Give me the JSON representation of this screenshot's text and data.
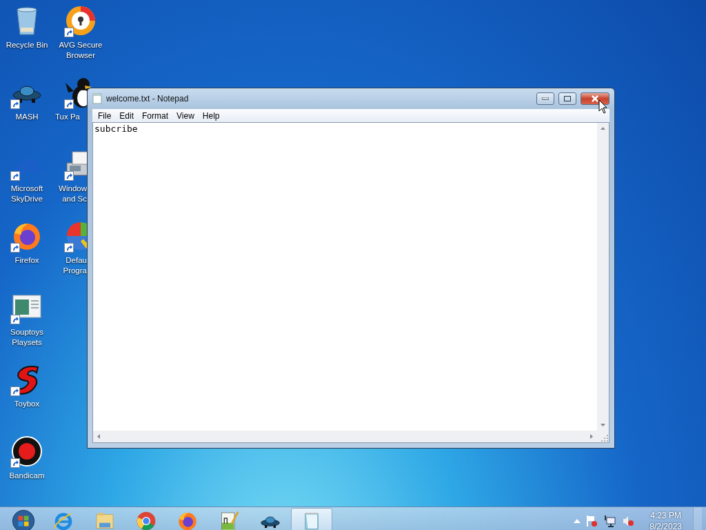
{
  "desktop_columns": [
    {
      "icons": [
        {
          "kind": "recycle-bin",
          "label": "Recycle Bin",
          "shortcut": false,
          "clipped": false
        },
        {
          "kind": "mash",
          "label": "MASH",
          "shortcut": true,
          "clipped": false
        },
        {
          "kind": "cloud",
          "label": "Microsoft SkyDrive",
          "shortcut": true,
          "clipped": false
        },
        {
          "kind": "firefox",
          "label": "Firefox",
          "shortcut": true,
          "clipped": false
        },
        {
          "kind": "playset",
          "label": "Souptoys Playsets",
          "shortcut": true,
          "clipped": false
        },
        {
          "kind": "toybox",
          "label": "Toybox",
          "shortcut": true,
          "clipped": false
        },
        {
          "kind": "bandicam",
          "label": "Bandicam",
          "shortcut": true,
          "clipped": false
        }
      ]
    },
    {
      "icons": [
        {
          "kind": "avg",
          "label": "AVG Secure Browser",
          "shortcut": true,
          "clipped": false
        },
        {
          "kind": "penguin",
          "label": "Tux Pa",
          "shortcut": true,
          "clipped": true
        },
        {
          "kind": "fax",
          "label": "Window and Sc",
          "shortcut": true,
          "clipped": true
        },
        {
          "kind": "defaults",
          "label": "Defau Progra",
          "shortcut": true,
          "clipped": true
        }
      ]
    }
  ],
  "window": {
    "title": "welcome.txt - Notepad",
    "menu": [
      "File",
      "Edit",
      "Format",
      "View",
      "Help"
    ],
    "text": "subcribe"
  },
  "taskbar": {
    "items": [
      {
        "kind": "start",
        "selected": false
      },
      {
        "kind": "ie",
        "selected": false
      },
      {
        "kind": "explorer",
        "selected": false
      },
      {
        "kind": "chrome",
        "selected": false
      },
      {
        "kind": "firefox",
        "selected": false
      },
      {
        "kind": "notepadpp",
        "selected": false
      },
      {
        "kind": "mash",
        "selected": false
      },
      {
        "kind": "notepad",
        "selected": true
      }
    ],
    "clock": {
      "time": "4:23 PM",
      "date": "8/2/2023"
    }
  }
}
